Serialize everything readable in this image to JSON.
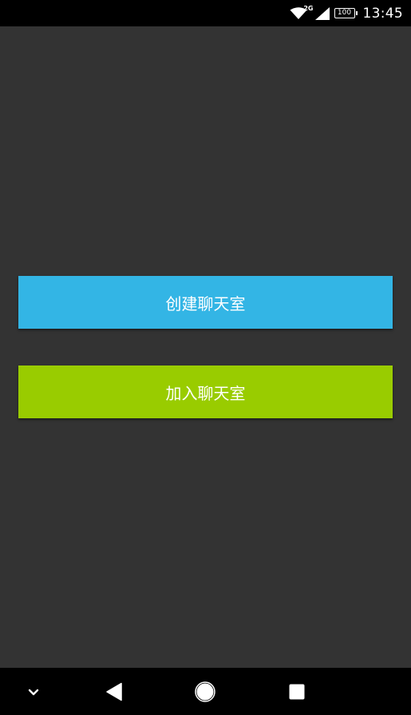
{
  "status_bar": {
    "network_type": "2G",
    "battery_level": "100",
    "time": "13:45",
    "icons": [
      "wifi-icon",
      "cell-signal-icon",
      "battery-icon"
    ]
  },
  "main": {
    "create_room_label": "创建聊天室",
    "join_room_label": "加入聊天室"
  },
  "nav_bar": {
    "icons": [
      "keyboard-hide-icon",
      "back-icon",
      "home-icon",
      "recents-icon"
    ]
  },
  "colors": {
    "background": "#333333",
    "create_button": "#33b5e5",
    "join_button": "#99cc00",
    "bars": "#000000"
  }
}
